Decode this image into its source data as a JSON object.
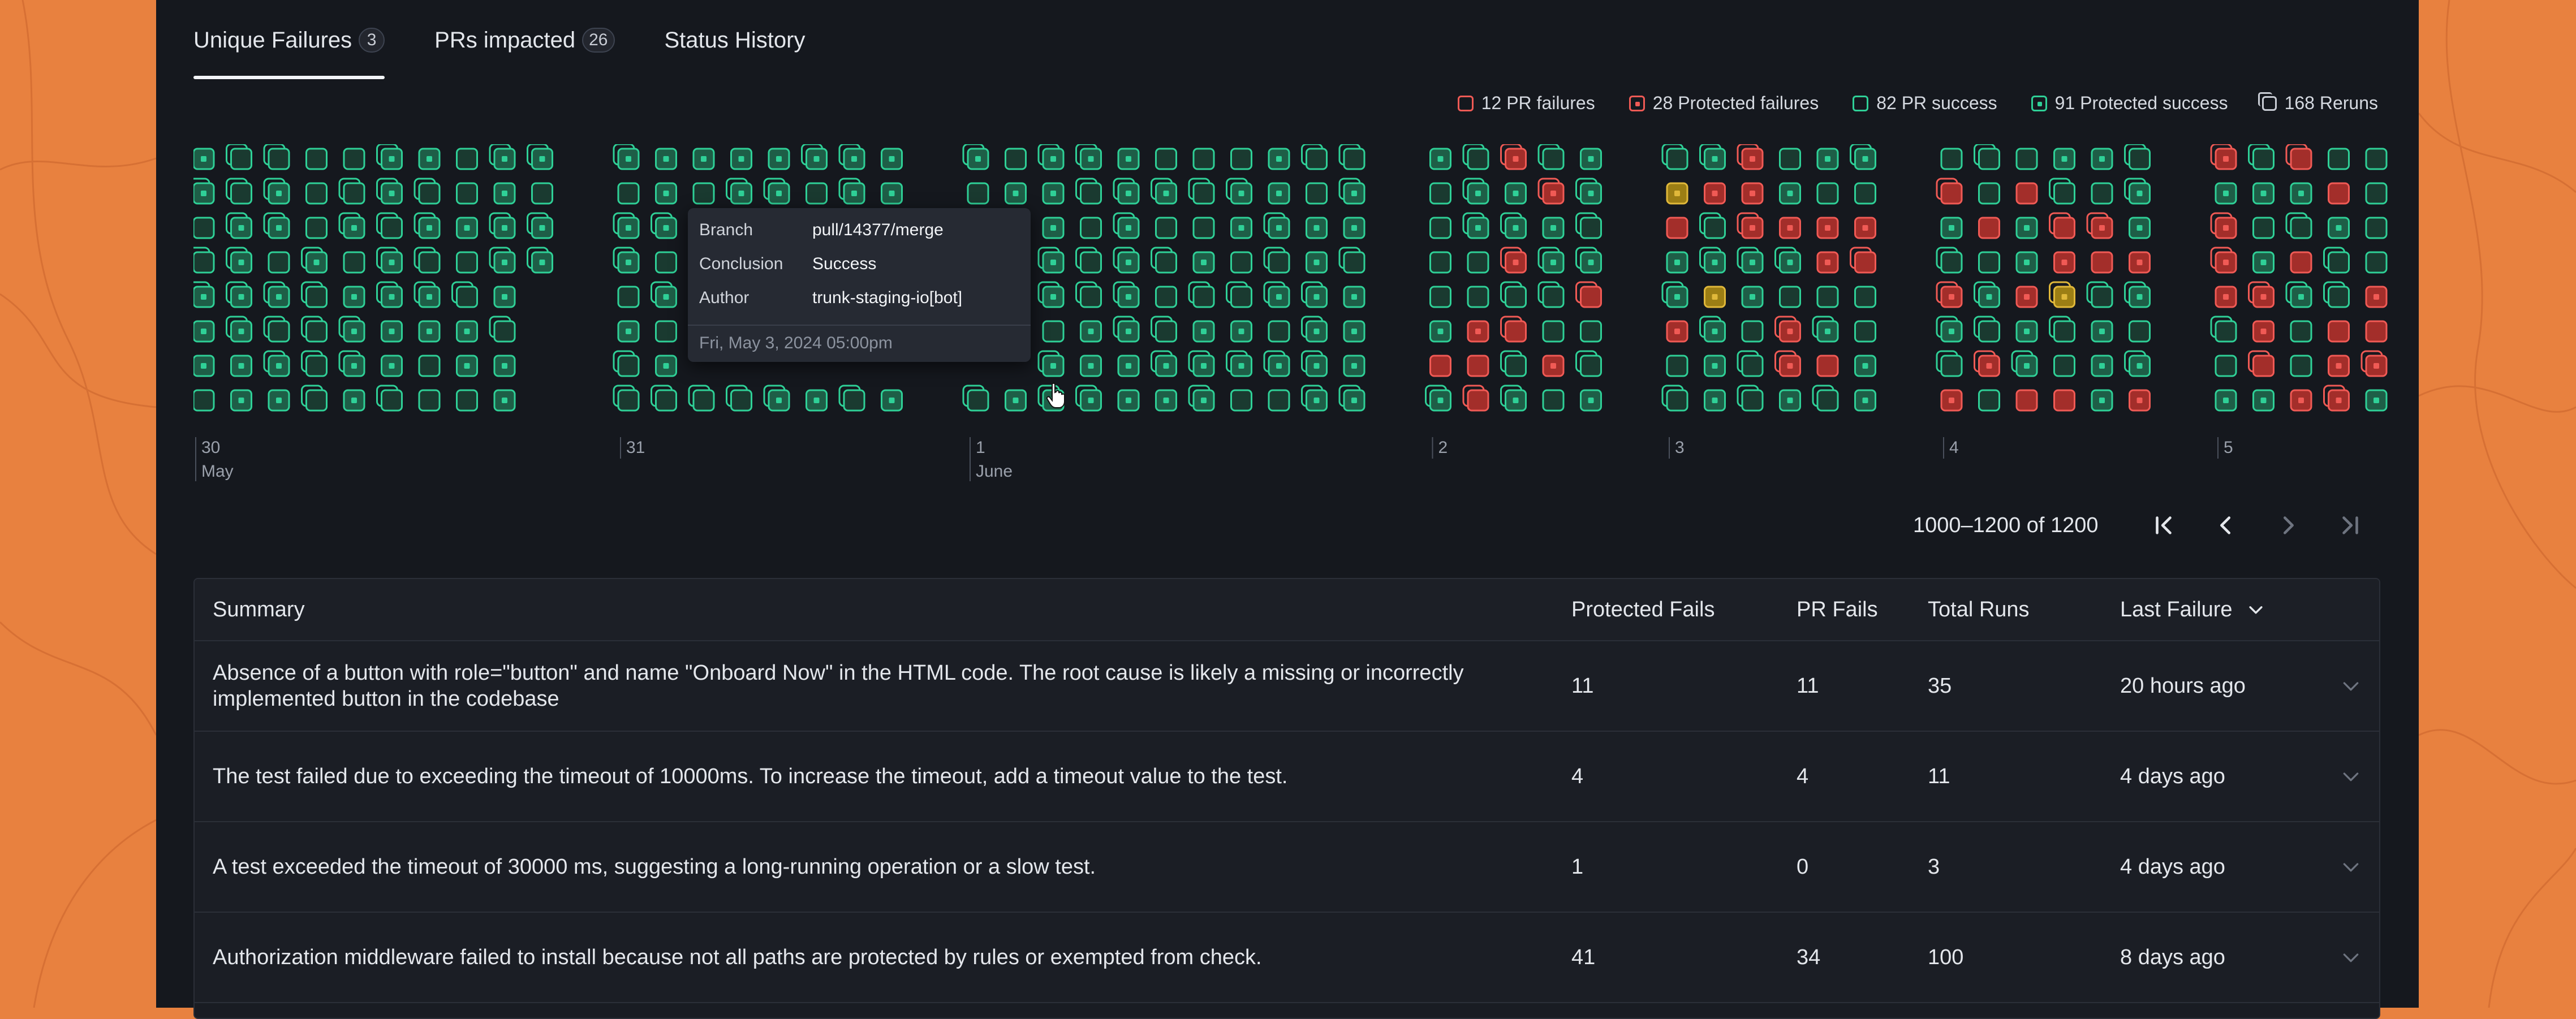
{
  "tabs": [
    {
      "label": "Unique Failures",
      "badge": "3"
    },
    {
      "label": "PRs impacted",
      "badge": "26"
    },
    {
      "label": "Status History",
      "badge": ""
    }
  ],
  "legend": [
    {
      "label": "12 PR failures",
      "kind": "pr-failure"
    },
    {
      "label": "28 Protected failures",
      "kind": "protected-failure"
    },
    {
      "label": "82 PR success",
      "kind": "pr-success"
    },
    {
      "label": "91 Protected success",
      "kind": "protected-success"
    },
    {
      "label": "168 Reruns",
      "kind": "reruns"
    }
  ],
  "colors": {
    "page_background": "#E8813F",
    "panel": "#15181E",
    "success": "#2FD097",
    "success_fill": "#1E5E47",
    "failure": "#F05A55",
    "failure_fill": "#A32E2A",
    "flaky": "#E0B83A",
    "flaky_fill": "#9C7E14"
  },
  "timeline": {
    "days": [
      {
        "label": "30",
        "month": "May",
        "columns": 10
      },
      {
        "label": "31",
        "month": "",
        "columns": 8
      },
      {
        "label": "1",
        "month": "June",
        "columns": 11
      },
      {
        "label": "2",
        "month": "",
        "columns": 5
      },
      {
        "label": "3",
        "month": "",
        "columns": 6
      },
      {
        "label": "4",
        "month": "",
        "columns": 6
      },
      {
        "label": "5",
        "month": "",
        "columns": 5
      }
    ]
  },
  "tooltip": {
    "branch_label": "Branch",
    "branch": "pull/14377/merge",
    "conclusion_label": "Conclusion",
    "conclusion": "Success",
    "author_label": "Author",
    "author": "trunk-staging-io[bot]",
    "date": "Fri, May 3, 2024 05:00pm"
  },
  "pagination": {
    "range": "1000–1200 of 1200"
  },
  "table": {
    "columns": {
      "summary": "Summary",
      "protected_fails": "Protected Fails",
      "pr_fails": "PR Fails",
      "total_runs": "Total Runs",
      "last_failure": "Last Failure"
    },
    "rows": [
      {
        "summary": "Absence of a button with role=\"button\" and name \"Onboard Now\" in the HTML code. The root cause is likely a missing or incorrectly implemented button in the codebase",
        "protected_fails": "11",
        "pr_fails": "11",
        "total_runs": "35",
        "last_failure": "20 hours ago"
      },
      {
        "summary": "The test failed due to exceeding the timeout of 10000ms. To increase the timeout, add a timeout value to the test.",
        "protected_fails": "4",
        "pr_fails": "4",
        "total_runs": "11",
        "last_failure": "4 days ago"
      },
      {
        "summary": "A test exceeded the timeout of 30000 ms, suggesting a long-running operation or a slow test.",
        "protected_fails": "1",
        "pr_fails": "0",
        "total_runs": "3",
        "last_failure": "4 days ago"
      },
      {
        "summary": "Authorization middleware failed to install because not all paths are protected by rules or exempted from check.",
        "protected_fails": "41",
        "pr_fails": "34",
        "total_runs": "100",
        "last_failure": "8 days ago"
      }
    ]
  }
}
